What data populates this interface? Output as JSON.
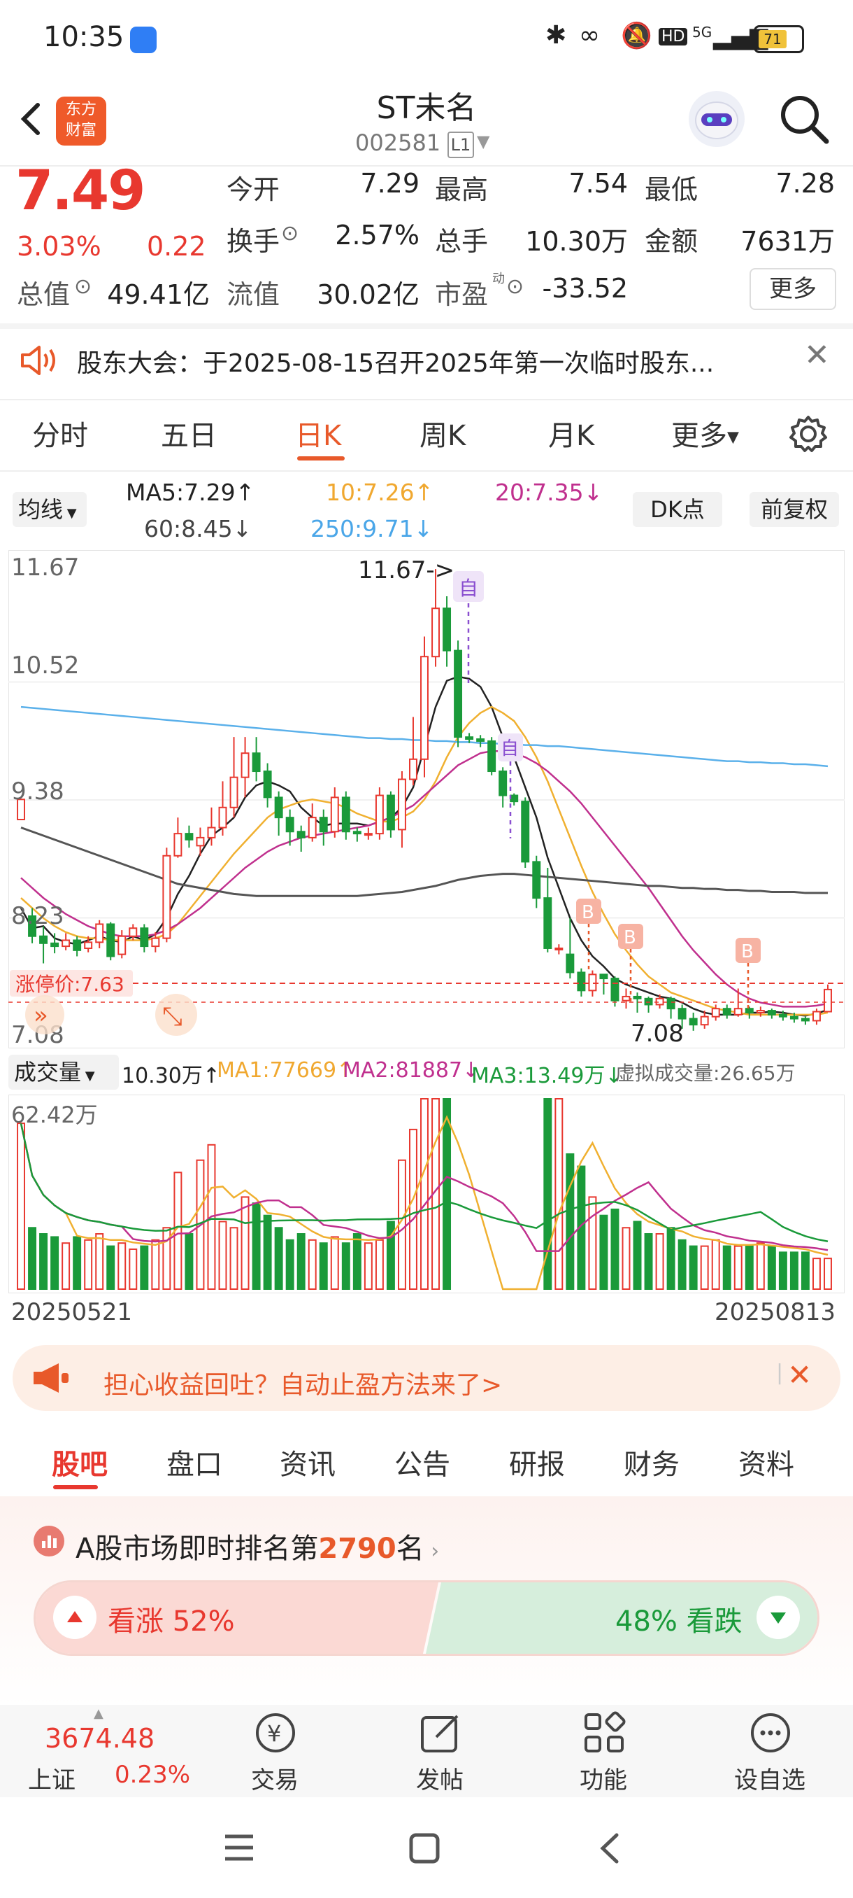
{
  "status_bar": {
    "time": "10:35",
    "net": "5G",
    "battery": "71"
  },
  "header": {
    "name": "ST未名",
    "code": "002581",
    "level": "L1",
    "logo_line1": "东方",
    "logo_line2": "财富"
  },
  "quote": {
    "price": "7.49",
    "change_pct": "3.03%",
    "change_amt": "0.22",
    "open_label": "今开",
    "open": "7.29",
    "high_label": "最高",
    "high": "7.54",
    "low_label": "最低",
    "low": "7.28",
    "turnover_label": "换手",
    "turnover": "2.57%",
    "volume_label": "总手",
    "volume": "10.30万",
    "amount_label": "金额",
    "amount": "7631万",
    "mktcap_label": "总值",
    "mktcap": "49.41亿",
    "float_label": "流值",
    "float_cap": "30.02亿",
    "pe_label": "市盈",
    "pe_sup": "动",
    "pe": "-33.52",
    "more_label": "更多"
  },
  "notice": {
    "text": "股东大会：于2025-08-15召开2025年第一次临时股东..."
  },
  "period_tabs": {
    "t1": "分时",
    "t2": "五日",
    "t3": "日K",
    "t4": "周K",
    "t5": "月K",
    "t6": "更多"
  },
  "ma": {
    "selector": "均线",
    "ma5": "MA5:7.29",
    "ma10": "10:7.26",
    "ma20": "20:7.35",
    "ma60": "60:8.45",
    "ma250": "250:9.71",
    "dk": "DK点",
    "fq": "前复权"
  },
  "kline": {
    "y_ticks": {
      "t1": "11.67",
      "t2": "10.52",
      "t3": "9.38",
      "t4": "8.23",
      "t5": "7.08"
    },
    "max_label": "11.67->",
    "min_label": "7.08",
    "limit_label": "涨停价:7.63",
    "mark_self": "自",
    "mark_b": "B"
  },
  "volume": {
    "selector": "成交量",
    "vol": "10.30万",
    "ma1": "MA1:77669",
    "ma2": "MA2:81887",
    "ma3": "MA3:13.49万",
    "virtual": "虚拟成交量:26.65万",
    "max_label": "62.42万",
    "date_start": "20250521",
    "date_end": "20250813"
  },
  "promo": {
    "text": "担心收益回吐？自动止盈方法来了>"
  },
  "bottom_tabs": {
    "t1": "股吧",
    "t2": "盘口",
    "t3": "资讯",
    "t4": "公告",
    "t5": "研报",
    "t6": "财务",
    "t7": "资料"
  },
  "rank": {
    "prefix": "A股市场即时排名第",
    "rank": "2790",
    "suffix": "名"
  },
  "vote": {
    "up_label": "看涨",
    "up_pct": "52%",
    "down_label": "看跌",
    "down_pct": "48%"
  },
  "footer": {
    "index_value": "3674.48",
    "index_name": "上证",
    "index_chg": "0.23%",
    "trade": "交易",
    "post": "发帖",
    "func": "功能",
    "watch": "设自选"
  },
  "colors": {
    "up": "#e8382f",
    "down": "#1a9a3a",
    "accent": "#e8592a"
  },
  "chart_data": {
    "type": "candlestick",
    "x_range": [
      "20250521",
      "20250813"
    ],
    "ylim": [
      7.08,
      11.67
    ],
    "candles": [
      [
        9.18,
        9.38,
        8.98,
        9.5
      ],
      [
        8.22,
        8.02,
        8.3,
        7.95
      ],
      [
        8.02,
        7.95,
        8.12,
        7.75
      ],
      [
        7.95,
        7.92,
        8.05,
        7.85
      ],
      [
        7.92,
        7.98,
        8.05,
        7.88
      ],
      [
        7.98,
        7.88,
        8.02,
        7.82
      ],
      [
        7.9,
        7.96,
        8.02,
        7.86
      ],
      [
        7.96,
        8.14,
        8.18,
        7.9
      ],
      [
        8.14,
        7.82,
        8.16,
        7.78
      ],
      [
        7.84,
        8.02,
        8.08,
        7.8
      ],
      [
        8.02,
        8.1,
        8.14,
        7.98
      ],
      [
        8.1,
        7.92,
        8.14,
        7.86
      ],
      [
        7.92,
        8.0,
        8.06,
        7.86
      ],
      [
        8.0,
        8.82,
        8.9,
        7.96
      ],
      [
        8.82,
        9.04,
        9.2,
        8.8
      ],
      [
        9.04,
        8.98,
        9.12,
        8.9
      ],
      [
        8.92,
        9.0,
        9.1,
        8.82
      ],
      [
        9.0,
        9.1,
        9.3,
        8.92
      ],
      [
        9.1,
        9.3,
        9.56,
        9.02
      ],
      [
        9.3,
        9.6,
        10.0,
        9.2
      ],
      [
        9.6,
        9.84,
        10.0,
        9.4
      ],
      [
        9.84,
        9.66,
        10.0,
        9.56
      ],
      [
        9.66,
        9.4,
        9.74,
        9.3
      ],
      [
        9.4,
        9.2,
        9.46,
        9.02
      ],
      [
        9.2,
        9.06,
        9.28,
        8.92
      ],
      [
        9.06,
        9.0,
        9.12,
        8.86
      ],
      [
        9.0,
        9.2,
        9.34,
        8.96
      ],
      [
        9.2,
        9.06,
        9.28,
        8.92
      ],
      [
        9.06,
        9.4,
        9.5,
        9.0
      ],
      [
        9.4,
        9.06,
        9.46,
        8.98
      ],
      [
        9.06,
        9.04,
        9.1,
        8.96
      ],
      [
        9.04,
        9.04,
        9.1,
        8.98
      ],
      [
        9.04,
        9.42,
        9.5,
        8.98
      ],
      [
        9.42,
        9.08,
        9.46,
        9.0
      ],
      [
        9.08,
        9.58,
        9.66,
        8.9
      ],
      [
        9.58,
        9.78,
        10.2,
        9.52
      ],
      [
        9.78,
        10.8,
        11.0,
        9.6
      ],
      [
        10.8,
        11.28,
        11.67,
        10.7
      ],
      [
        11.28,
        10.86,
        11.4,
        10.7
      ],
      [
        10.86,
        10.0,
        10.96,
        9.9
      ],
      [
        10.0,
        9.98,
        10.04,
        9.94
      ],
      [
        9.98,
        9.96,
        10.02,
        9.9
      ],
      [
        9.96,
        9.66,
        10.0,
        9.62
      ],
      [
        9.66,
        9.42,
        9.7,
        9.3
      ],
      [
        9.42,
        9.36,
        9.44,
        9.32
      ],
      [
        9.36,
        8.76,
        9.4,
        8.7
      ],
      [
        8.76,
        8.4,
        8.82,
        8.3
      ],
      [
        8.4,
        7.9,
        8.7,
        7.86
      ],
      [
        7.9,
        7.9,
        7.94,
        7.84
      ],
      [
        7.84,
        7.66,
        8.2,
        7.6
      ],
      [
        7.66,
        7.48,
        7.7,
        7.42
      ],
      [
        7.48,
        7.64,
        7.68,
        7.42
      ],
      [
        7.64,
        7.6,
        7.64,
        7.44
      ],
      [
        7.6,
        7.38,
        7.62,
        7.32
      ],
      [
        7.38,
        7.42,
        7.5,
        7.3
      ],
      [
        7.42,
        7.4,
        7.46,
        7.26
      ],
      [
        7.4,
        7.34,
        7.42,
        7.26
      ],
      [
        7.34,
        7.4,
        7.44,
        7.3
      ],
      [
        7.4,
        7.3,
        7.42,
        7.2
      ],
      [
        7.3,
        7.2,
        7.34,
        7.1
      ],
      [
        7.2,
        7.14,
        7.26,
        7.08
      ],
      [
        7.14,
        7.22,
        7.28,
        7.1
      ],
      [
        7.22,
        7.3,
        7.34,
        7.18
      ],
      [
        7.3,
        7.24,
        7.34,
        7.2
      ],
      [
        7.24,
        7.3,
        7.5,
        7.22
      ],
      [
        7.3,
        7.26,
        7.32,
        7.2
      ],
      [
        7.26,
        7.28,
        7.32,
        7.22
      ],
      [
        7.28,
        7.24,
        7.3,
        7.2
      ],
      [
        7.24,
        7.22,
        7.28,
        7.18
      ],
      [
        7.22,
        7.2,
        7.26,
        7.16
      ],
      [
        7.2,
        7.18,
        7.22,
        7.14
      ],
      [
        7.18,
        7.27,
        7.3,
        7.14
      ],
      [
        7.27,
        7.49,
        7.54,
        7.28
      ]
    ],
    "series": [
      {
        "name": "MA5",
        "values": [
          8.3,
          8.1,
          8.12,
          8.0,
          7.96,
          7.94,
          7.98,
          8.02,
          7.98,
          7.96,
          8.02,
          7.98,
          8.04,
          8.2,
          8.44,
          8.62,
          8.84,
          9.02,
          9.1,
          9.2,
          9.4,
          9.52,
          9.56,
          9.52,
          9.46,
          9.3,
          9.2,
          9.12,
          9.14,
          9.14,
          9.14,
          9.12,
          9.16,
          9.2,
          9.3,
          9.5,
          9.9,
          10.3,
          10.56,
          10.6,
          10.58,
          10.5,
          10.3,
          10.0,
          9.8,
          9.5,
          9.2,
          8.8,
          8.5,
          8.2,
          7.98,
          7.82,
          7.72,
          7.6,
          7.54,
          7.5,
          7.46,
          7.42,
          7.4,
          7.36,
          7.3,
          7.26,
          7.24,
          7.24,
          7.24,
          7.26,
          7.26,
          7.27,
          7.26,
          7.24,
          7.23,
          7.25,
          7.29
        ]
      },
      {
        "name": "MA10",
        "values": [
          8.4,
          8.3,
          8.2,
          8.12,
          8.06,
          8.02,
          8.0,
          8.0,
          7.98,
          7.98,
          7.98,
          7.98,
          8.0,
          8.04,
          8.14,
          8.28,
          8.42,
          8.56,
          8.7,
          8.84,
          8.96,
          9.08,
          9.2,
          9.28,
          9.32,
          9.36,
          9.38,
          9.36,
          9.34,
          9.3,
          9.24,
          9.2,
          9.16,
          9.16,
          9.2,
          9.26,
          9.38,
          9.56,
          9.8,
          10.0,
          10.14,
          10.24,
          10.3,
          10.24,
          10.16,
          10.0,
          9.8,
          9.56,
          9.28,
          9.0,
          8.72,
          8.46,
          8.24,
          8.04,
          7.88,
          7.74,
          7.62,
          7.54,
          7.46,
          7.42,
          7.38,
          7.34,
          7.3,
          7.28,
          7.26,
          7.24,
          7.24,
          7.24,
          7.24,
          7.24,
          7.24,
          7.24,
          7.26
        ]
      },
      {
        "name": "MA20",
        "values": [
          8.6,
          8.5,
          8.4,
          8.32,
          8.24,
          8.18,
          8.12,
          8.08,
          8.04,
          8.02,
          8.02,
          8.02,
          8.04,
          8.08,
          8.14,
          8.22,
          8.3,
          8.4,
          8.5,
          8.6,
          8.7,
          8.78,
          8.86,
          8.92,
          8.96,
          9.0,
          9.02,
          9.04,
          9.06,
          9.08,
          9.1,
          9.12,
          9.16,
          9.2,
          9.26,
          9.32,
          9.42,
          9.52,
          9.62,
          9.72,
          9.78,
          9.84,
          9.86,
          9.86,
          9.84,
          9.8,
          9.74,
          9.66,
          9.56,
          9.46,
          9.34,
          9.2,
          9.06,
          8.92,
          8.78,
          8.64,
          8.5,
          8.34,
          8.18,
          8.02,
          7.88,
          7.76,
          7.64,
          7.54,
          7.46,
          7.4,
          7.36,
          7.34,
          7.32,
          7.32,
          7.32,
          7.33,
          7.35
        ]
      },
      {
        "name": "MA60",
        "values": [
          9.1,
          9.06,
          9.02,
          8.98,
          8.94,
          8.9,
          8.86,
          8.82,
          8.78,
          8.74,
          8.7,
          8.66,
          8.62,
          8.58,
          8.54,
          8.52,
          8.5,
          8.48,
          8.46,
          8.44,
          8.43,
          8.42,
          8.42,
          8.42,
          8.42,
          8.42,
          8.42,
          8.42,
          8.42,
          8.42,
          8.42,
          8.43,
          8.44,
          8.45,
          8.46,
          8.48,
          8.5,
          8.52,
          8.55,
          8.58,
          8.6,
          8.62,
          8.63,
          8.64,
          8.64,
          8.63,
          8.62,
          8.61,
          8.6,
          8.59,
          8.58,
          8.57,
          8.56,
          8.55,
          8.54,
          8.53,
          8.52,
          8.52,
          8.51,
          8.5,
          8.5,
          8.49,
          8.49,
          8.48,
          8.48,
          8.47,
          8.47,
          8.46,
          8.46,
          8.46,
          8.45,
          8.45,
          8.45
        ]
      },
      {
        "name": "MA250",
        "values": [
          10.3,
          10.29,
          10.28,
          10.27,
          10.26,
          10.25,
          10.24,
          10.23,
          10.22,
          10.21,
          10.2,
          10.19,
          10.18,
          10.17,
          10.16,
          10.15,
          10.14,
          10.13,
          10.12,
          10.11,
          10.1,
          10.09,
          10.08,
          10.07,
          10.06,
          10.05,
          10.04,
          10.03,
          10.02,
          10.01,
          10.0,
          9.99,
          9.99,
          9.98,
          9.98,
          9.97,
          9.97,
          9.96,
          9.96,
          9.95,
          9.95,
          9.94,
          9.94,
          9.93,
          9.93,
          9.92,
          9.92,
          9.91,
          9.91,
          9.9,
          9.89,
          9.88,
          9.87,
          9.86,
          9.85,
          9.84,
          9.83,
          9.82,
          9.81,
          9.8,
          9.79,
          9.78,
          9.77,
          9.76,
          9.76,
          9.75,
          9.75,
          9.74,
          9.74,
          9.73,
          9.73,
          9.72,
          9.71
        ]
      }
    ],
    "volume": [
      54,
      20,
      18,
      17,
      15,
      17,
      16,
      18,
      14,
      15,
      13,
      14,
      16,
      20,
      38,
      18,
      42,
      47,
      22,
      20,
      30,
      28,
      24,
      20,
      16,
      18,
      16,
      15,
      17,
      15,
      18,
      15,
      16,
      22,
      42,
      52,
      62,
      62,
      62,
      0,
      0,
      0,
      0,
      0,
      0,
      0,
      0,
      62,
      62,
      44,
      40,
      30,
      24,
      26,
      20,
      22,
      18,
      18,
      20,
      16,
      14,
      14,
      16,
      14,
      14,
      14,
      15,
      14,
      12,
      12,
      12,
      10,
      10
    ]
  }
}
